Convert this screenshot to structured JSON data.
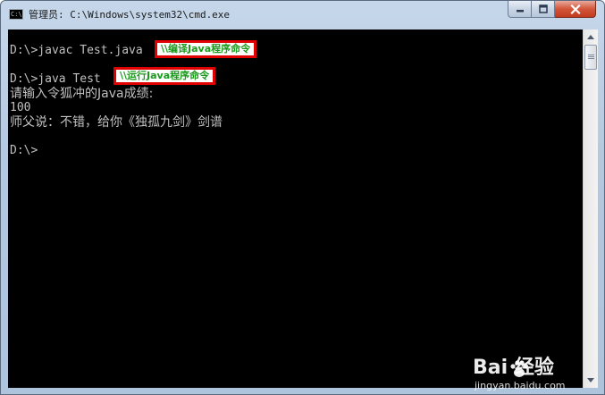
{
  "window": {
    "title": "管理员: C:\\Windows\\system32\\cmd.exe",
    "icon": "cmd-icon",
    "buttons": {
      "minimize": "minimize-icon",
      "maximize": "maximize-icon",
      "close": "close-icon"
    }
  },
  "console": {
    "lines": [
      "D:\\>javac Test.java",
      "D:\\>java Test",
      "请输入令狐冲的Java成绩:",
      "100",
      "师父说：不错，给你《独孤九剑》剑谱",
      "D:\\>"
    ],
    "colors": {
      "background": "#000000",
      "text": "#c0c0c0"
    }
  },
  "annotations": {
    "compile": "\\\\编译Java程序命令",
    "run": "\\\\运行Java程序命令",
    "colors": {
      "border": "#e00000",
      "text": "#1a9a1a"
    }
  },
  "watermark": {
    "brand": "Bai 经验",
    "url": "jingyan.baidu.com"
  }
}
